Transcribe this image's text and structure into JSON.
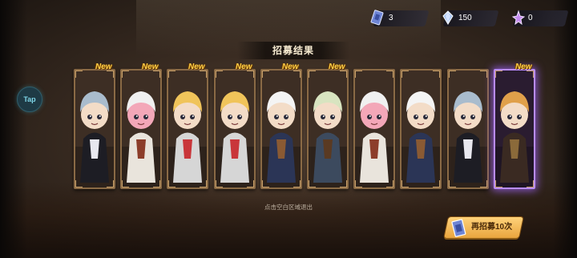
{
  "resources": [
    {
      "icon": "blue-ticket-icon",
      "value": "3"
    },
    {
      "icon": "crystal-gem-icon",
      "value": "150"
    },
    {
      "icon": "purple-star-icon",
      "value": "0"
    }
  ],
  "tap_label": "Tap",
  "title": "招募结果",
  "new_label": "New",
  "cards": [
    {
      "name": "maid-character",
      "new": true,
      "rarity": "normal",
      "palette": {
        "hair": "#a9bccd",
        "skin": "#f3dcc7",
        "outfit": "#1d1d24",
        "accent": "#e8e8ef"
      }
    },
    {
      "name": "chef-character",
      "new": true,
      "rarity": "normal",
      "palette": {
        "hair": "#f0f0f0",
        "skin": "#f3a7b8",
        "outfit": "#e9e4dc",
        "accent": "#8c3d2a"
      }
    },
    {
      "name": "blonde-fighter-character",
      "new": true,
      "rarity": "normal",
      "palette": {
        "hair": "#f0c45a",
        "skin": "#f3dcc7",
        "outfit": "#d6d6d6",
        "accent": "#c9363a"
      }
    },
    {
      "name": "blonde-fighter-duplicate",
      "new": true,
      "rarity": "normal",
      "palette": {
        "hair": "#f0c45a",
        "skin": "#f3dcc7",
        "outfit": "#d6d6d6",
        "accent": "#c9363a"
      }
    },
    {
      "name": "eggshell-character",
      "new": true,
      "rarity": "normal",
      "palette": {
        "hair": "#f4f4f4",
        "skin": "#f3dcc7",
        "outfit": "#2b3556",
        "accent": "#8a5a33"
      }
    },
    {
      "name": "aviator-character",
      "new": true,
      "rarity": "normal",
      "palette": {
        "hair": "#d8e4c0",
        "skin": "#f3dcc7",
        "outfit": "#3c4a5e",
        "accent": "#5a3a22"
      }
    },
    {
      "name": "chef-duplicate",
      "new": false,
      "rarity": "normal",
      "palette": {
        "hair": "#f0f0f0",
        "skin": "#f3a7b8",
        "outfit": "#e9e4dc",
        "accent": "#8c3d2a"
      }
    },
    {
      "name": "eggshell-duplicate",
      "new": false,
      "rarity": "normal",
      "palette": {
        "hair": "#f4f4f4",
        "skin": "#f3dcc7",
        "outfit": "#2b3556",
        "accent": "#8a5a33"
      }
    },
    {
      "name": "maid-duplicate",
      "new": false,
      "rarity": "normal",
      "palette": {
        "hair": "#a9bccd",
        "skin": "#f3dcc7",
        "outfit": "#1d1d24",
        "accent": "#e8e8ef"
      }
    },
    {
      "name": "goggles-engineer-character",
      "new": true,
      "rarity": "legendary",
      "palette": {
        "hair": "#e0a04a",
        "skin": "#f3dcc7",
        "outfit": "#3a2a22",
        "accent": "#8b6a3a"
      }
    }
  ],
  "hint": "点击空白区域退出",
  "recruit_button": {
    "label": "再招募10次",
    "icon": "recruit-ticket-icon"
  },
  "colors": {
    "gold": "#ffd14a",
    "legendary_glow": "#b98cff",
    "frame": "#8a6a45"
  }
}
